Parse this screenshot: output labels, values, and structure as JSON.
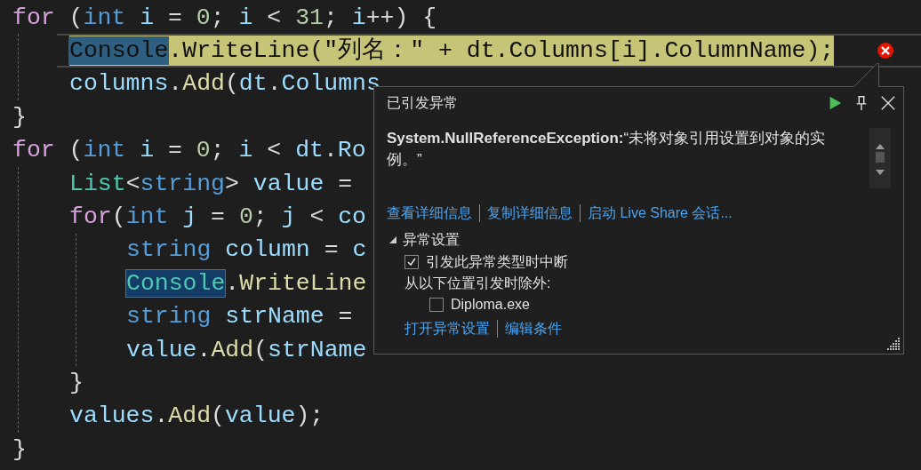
{
  "editor": {
    "lines": [
      {
        "current": false,
        "tokens": [
          {
            "kind": "keyword",
            "text": "for",
            "selected": false
          },
          {
            "kind": "punct",
            "text": " (",
            "selected": false
          },
          {
            "kind": "type",
            "text": "int",
            "selected": false
          },
          {
            "kind": "ident",
            "text": " i ",
            "selected": false
          },
          {
            "kind": "punct",
            "text": "= ",
            "selected": false
          },
          {
            "kind": "number",
            "text": "0",
            "selected": false
          },
          {
            "kind": "punct",
            "text": "; ",
            "selected": false
          },
          {
            "kind": "ident",
            "text": "i",
            "selected": false
          },
          {
            "kind": "punct",
            "text": " < ",
            "selected": false
          },
          {
            "kind": "number",
            "text": "31",
            "selected": false
          },
          {
            "kind": "punct",
            "text": "; ",
            "selected": false
          },
          {
            "kind": "ident",
            "text": "i",
            "selected": false
          },
          {
            "kind": "punct",
            "text": "++) {",
            "selected": false
          }
        ],
        "children": [
          {
            "current": true,
            "tokens": [
              {
                "text": "Console",
                "selected": true
              },
              {
                "text": ".WriteLine(\"列名：\" + dt.Columns[i].ColumnName);",
                "selected": false
              }
            ]
          },
          {
            "current": false,
            "tokens": [
              {
                "kind": "ident",
                "text": "columns",
                "selected": false
              },
              {
                "kind": "punct",
                "text": ".",
                "selected": false
              },
              {
                "kind": "method",
                "text": "Add",
                "selected": false
              },
              {
                "kind": "punct",
                "text": "(",
                "selected": false
              },
              {
                "kind": "ident",
                "text": "dt",
                "selected": false
              },
              {
                "kind": "punct",
                "text": ".",
                "selected": false
              },
              {
                "kind": "ident",
                "text": "Columns",
                "selected": false
              }
            ]
          }
        ]
      },
      {
        "current": false,
        "tokens": [
          {
            "kind": "punct",
            "text": "}",
            "selected": false
          }
        ]
      },
      {
        "current": false,
        "tokens": [
          {
            "kind": "keyword",
            "text": "for",
            "selected": false
          },
          {
            "kind": "punct",
            "text": " (",
            "selected": false
          },
          {
            "kind": "type",
            "text": "int",
            "selected": false
          },
          {
            "kind": "ident",
            "text": " i ",
            "selected": false
          },
          {
            "kind": "punct",
            "text": "= ",
            "selected": false
          },
          {
            "kind": "number",
            "text": "0",
            "selected": false
          },
          {
            "kind": "punct",
            "text": "; ",
            "selected": false
          },
          {
            "kind": "ident",
            "text": "i",
            "selected": false
          },
          {
            "kind": "punct",
            "text": " < ",
            "selected": false
          },
          {
            "kind": "ident",
            "text": "dt",
            "selected": false
          },
          {
            "kind": "punct",
            "text": ".",
            "selected": false
          },
          {
            "kind": "ident",
            "text": "Ro",
            "selected": false
          }
        ],
        "children": [
          {
            "current": false,
            "tokens": [
              {
                "kind": "class",
                "text": "List",
                "selected": false
              },
              {
                "kind": "punct",
                "text": "<",
                "selected": false
              },
              {
                "kind": "type",
                "text": "string",
                "selected": false
              },
              {
                "kind": "punct",
                "text": "> ",
                "selected": false
              },
              {
                "kind": "ident",
                "text": "value",
                "selected": false
              },
              {
                "kind": "punct",
                "text": " =",
                "selected": false
              }
            ]
          },
          {
            "current": false,
            "tokens": [
              {
                "kind": "keyword",
                "text": "for",
                "selected": false
              },
              {
                "kind": "punct",
                "text": "(",
                "selected": false
              },
              {
                "kind": "type",
                "text": "int",
                "selected": false
              },
              {
                "kind": "ident",
                "text": " j ",
                "selected": false
              },
              {
                "kind": "punct",
                "text": "= ",
                "selected": false
              },
              {
                "kind": "number",
                "text": "0",
                "selected": false
              },
              {
                "kind": "punct",
                "text": "; ",
                "selected": false
              },
              {
                "kind": "ident",
                "text": "j",
                "selected": false
              },
              {
                "kind": "punct",
                "text": " < ",
                "selected": false
              },
              {
                "kind": "ident",
                "text": "co",
                "selected": false
              }
            ],
            "children": [
              {
                "current": false,
                "tokens": [
                  {
                    "kind": "type",
                    "text": "string",
                    "selected": false
                  },
                  {
                    "kind": "ident",
                    "text": " column ",
                    "selected": false
                  },
                  {
                    "kind": "punct",
                    "text": "= ",
                    "selected": false
                  },
                  {
                    "kind": "ident",
                    "text": "c",
                    "selected": false
                  }
                ]
              },
              {
                "current": false,
                "tokens": [
                  {
                    "kind": "class",
                    "text": "Console",
                    "selected": true
                  },
                  {
                    "kind": "punct",
                    "text": ".",
                    "selected": false
                  },
                  {
                    "kind": "method",
                    "text": "WriteLine",
                    "selected": false
                  }
                ]
              },
              {
                "current": false,
                "tokens": [
                  {
                    "kind": "type",
                    "text": "string",
                    "selected": false
                  },
                  {
                    "kind": "ident",
                    "text": " strName ",
                    "selected": false
                  },
                  {
                    "kind": "punct",
                    "text": "=",
                    "selected": false
                  }
                ]
              },
              {
                "current": false,
                "tokens": [
                  {
                    "kind": "ident",
                    "text": "value",
                    "selected": false
                  },
                  {
                    "kind": "punct",
                    "text": ".",
                    "selected": false
                  },
                  {
                    "kind": "method",
                    "text": "Add",
                    "selected": false
                  },
                  {
                    "kind": "punct",
                    "text": "(",
                    "selected": false
                  },
                  {
                    "kind": "ident",
                    "text": "strName",
                    "selected": false
                  }
                ]
              }
            ]
          },
          {
            "current": false,
            "tokens": [
              {
                "kind": "punct",
                "text": "}",
                "selected": false
              }
            ]
          },
          {
            "current": false,
            "tokens": [
              {
                "kind": "ident",
                "text": "values",
                "selected": false
              },
              {
                "kind": "punct",
                "text": ".",
                "selected": false
              },
              {
                "kind": "method",
                "text": "Add",
                "selected": false
              },
              {
                "kind": "punct",
                "text": "(",
                "selected": false
              },
              {
                "kind": "ident",
                "text": "value",
                "selected": false
              },
              {
                "kind": "punct",
                "text": ");",
                "selected": false
              }
            ]
          }
        ]
      },
      {
        "current": false,
        "tokens": [
          {
            "kind": "punct",
            "text": "}",
            "selected": false
          }
        ]
      }
    ]
  },
  "exception_popup": {
    "title": "已引发异常",
    "message": "**System.NullReferenceException:**“未将对象引用设置到对象的实例。”",
    "links": [
      "查看详细信息",
      "复制详细信息",
      "启动 Live Share 会话..."
    ],
    "settings": {
      "title": "异常设置",
      "expanded": true,
      "items": [
        {
          "kind": "checkbox",
          "label": "引发此异常类型时中断",
          "checked": true
        },
        {
          "kind": "label",
          "label": "从以下位置引发时除外:",
          "children": [
            {
              "kind": "checkbox",
              "label": "Diploma.exe",
              "checked": false
            }
          ]
        }
      ]
    },
    "footer_links": [
      "打开异常设置",
      "编辑条件"
    ]
  }
}
